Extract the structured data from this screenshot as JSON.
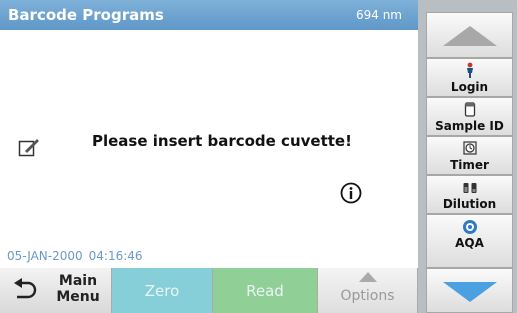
{
  "header": {
    "title": "Barcode Programs",
    "wavelength": "694 nm"
  },
  "main": {
    "message": "Please insert barcode cuvette!",
    "date": "05-JAN-2000",
    "time": "04:16:46"
  },
  "bottom_bar": {
    "main_menu_label": "Main\nMenu",
    "zero_label": "Zero",
    "read_label": "Read",
    "options_label": "Options"
  },
  "tools": [
    {
      "label": "Login",
      "icon": "login-person-icon"
    },
    {
      "label": "Sample ID",
      "icon": "sample-id-icon"
    },
    {
      "label": "Timer",
      "icon": "timer-icon"
    },
    {
      "label": "Dilution",
      "icon": "dilution-icon"
    },
    {
      "label": "AQA",
      "icon": "aqa-icon"
    }
  ],
  "colors": {
    "header": "#6fa4d2",
    "zero_button": "#86cfd8",
    "read_button": "#90cf96",
    "side_panel": "#b9bec3",
    "scroll_arrow_up": "#a8a8a8",
    "scroll_arrow_down": "#4aa0e0"
  }
}
